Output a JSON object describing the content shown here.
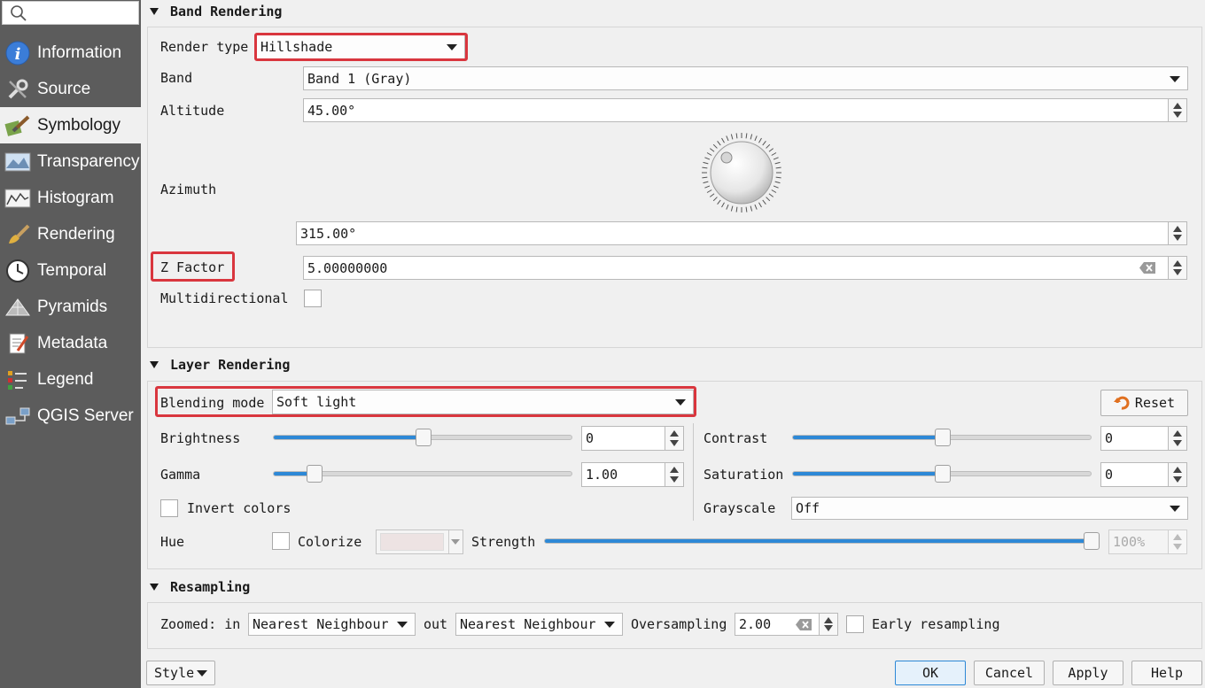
{
  "sidebar": {
    "search_placeholder": "",
    "items": [
      {
        "label": "Information",
        "icon": "info-icon"
      },
      {
        "label": "Source",
        "icon": "wrench-icon"
      },
      {
        "label": "Symbology",
        "icon": "paintbrush-icon",
        "active": true
      },
      {
        "label": "Transparency",
        "icon": "transparency-icon"
      },
      {
        "label": "Histogram",
        "icon": "histogram-icon"
      },
      {
        "label": "Rendering",
        "icon": "brush-icon"
      },
      {
        "label": "Temporal",
        "icon": "clock-icon"
      },
      {
        "label": "Pyramids",
        "icon": "pyramid-icon"
      },
      {
        "label": "Metadata",
        "icon": "metadata-icon"
      },
      {
        "label": "Legend",
        "icon": "legend-icon"
      },
      {
        "label": "QGIS Server",
        "icon": "server-icon"
      }
    ]
  },
  "band_rendering": {
    "title": "Band Rendering",
    "render_type_label": "Render type",
    "render_type_value": "Hillshade",
    "band_label": "Band",
    "band_value": "Band 1 (Gray)",
    "altitude_label": "Altitude",
    "altitude_value": "45.00°",
    "azimuth_label": "Azimuth",
    "azimuth_value": "315.00°",
    "zfactor_label": "Z Factor",
    "zfactor_value": "5.00000000",
    "multidirectional_label": "Multidirectional",
    "multidirectional_checked": false
  },
  "layer_rendering": {
    "title": "Layer Rendering",
    "blending_label": "Blending mode",
    "blending_value": "Soft light",
    "reset_label": "Reset",
    "brightness_label": "Brightness",
    "brightness_value": "0",
    "brightness_level": 0.5,
    "contrast_label": "Contrast",
    "contrast_value": "0",
    "contrast_level": 0.5,
    "gamma_label": "Gamma",
    "gamma_value": "1.00",
    "gamma_level": 0.115,
    "saturation_label": "Saturation",
    "saturation_value": "0",
    "saturation_level": 0.5,
    "invert_label": "Invert colors",
    "invert_checked": false,
    "grayscale_label": "Grayscale",
    "grayscale_value": "Off",
    "hue_label": "Hue",
    "colorize_label": "Colorize",
    "colorize_checked": false,
    "colorize_color": "#ede3e3",
    "strength_label": "Strength",
    "strength_value": "100%",
    "strength_level": 1.0
  },
  "resampling": {
    "title": "Resampling",
    "zoomed_in_label": "Zoomed: in",
    "zoomed_in_value": "Nearest Neighbour",
    "out_label": "out",
    "out_value": "Nearest Neighbour",
    "oversampling_label": "Oversampling",
    "oversampling_value": "2.00",
    "early_label": "Early resampling",
    "early_checked": false
  },
  "footer": {
    "style_label": "Style",
    "ok_label": "OK",
    "cancel_label": "Cancel",
    "apply_label": "Apply",
    "help_label": "Help"
  },
  "colors": {
    "highlight_red": "#d9363e",
    "slider_blue": "#2d88d6",
    "sidebar_bg": "#5c5c5c"
  }
}
